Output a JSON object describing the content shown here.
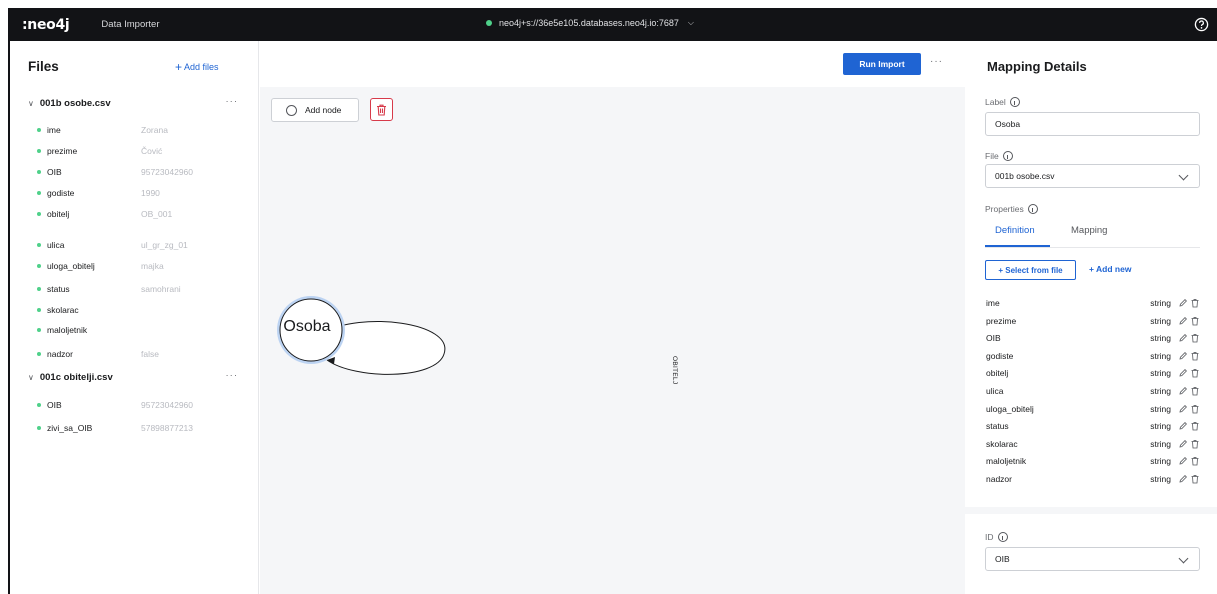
{
  "topbar": {
    "logo": ":neo4j",
    "app_name": "Data Importer",
    "connection": "neo4j+s://36e5e105.databases.neo4j.io:7687",
    "connection_chevron": "⌵"
  },
  "files_panel": {
    "title": "Files",
    "add_files_label": "Add files",
    "files": [
      {
        "name": "001b osobe.csv",
        "columns": [
          {
            "name": "ime",
            "sample": "Zorana"
          },
          {
            "name": "prezime",
            "sample": "Čović"
          },
          {
            "name": "OIB",
            "sample": "95723042960"
          },
          {
            "name": "godiste",
            "sample": "1990"
          },
          {
            "name": "obitelj",
            "sample": "OB_001"
          },
          {
            "name": "ulica",
            "sample": "ul_gr_zg_01"
          },
          {
            "name": "uloga_obitelj",
            "sample": "majka"
          },
          {
            "name": "status",
            "sample": "samohrani"
          },
          {
            "name": "skolarac",
            "sample": ""
          },
          {
            "name": "maloljetnik",
            "sample": ""
          },
          {
            "name": "nadzor",
            "sample": "false"
          }
        ]
      },
      {
        "name": "001c obitelji.csv",
        "columns": [
          {
            "name": "OIB",
            "sample": "95723042960"
          },
          {
            "name": "zivi_sa_OIB",
            "sample": "57898877213"
          }
        ]
      }
    ],
    "more_label": "···"
  },
  "canvas": {
    "run_import_label": "Run Import",
    "more_label": "···",
    "add_node_label": "Add node",
    "node_label": "Osoba",
    "relationship_label": "OBITELJ"
  },
  "mapping": {
    "title": "Mapping Details",
    "label_caption": "Label",
    "label_value": "Osoba",
    "file_caption": "File",
    "file_value": "001b osobe.csv",
    "properties_caption": "Properties",
    "tab_definition": "Definition",
    "tab_mapping": "Mapping",
    "select_from_file": "+ Select from file",
    "add_new": "+ Add new",
    "properties": [
      {
        "name": "ime",
        "type": "string"
      },
      {
        "name": "prezime",
        "type": "string"
      },
      {
        "name": "OIB",
        "type": "string"
      },
      {
        "name": "godiste",
        "type": "string"
      },
      {
        "name": "obitelj",
        "type": "string"
      },
      {
        "name": "ulica",
        "type": "string"
      },
      {
        "name": "uloga_obitelj",
        "type": "string"
      },
      {
        "name": "status",
        "type": "string"
      },
      {
        "name": "skolarac",
        "type": "string"
      },
      {
        "name": "maloljetnik",
        "type": "string"
      },
      {
        "name": "nadzor",
        "type": "string"
      }
    ],
    "id_caption": "ID",
    "id_value": "OIB"
  },
  "colors": {
    "accent": "#1f64d3",
    "topbar": "#121316",
    "column_dot": "#4fd18a",
    "danger": "#d73a4a"
  }
}
